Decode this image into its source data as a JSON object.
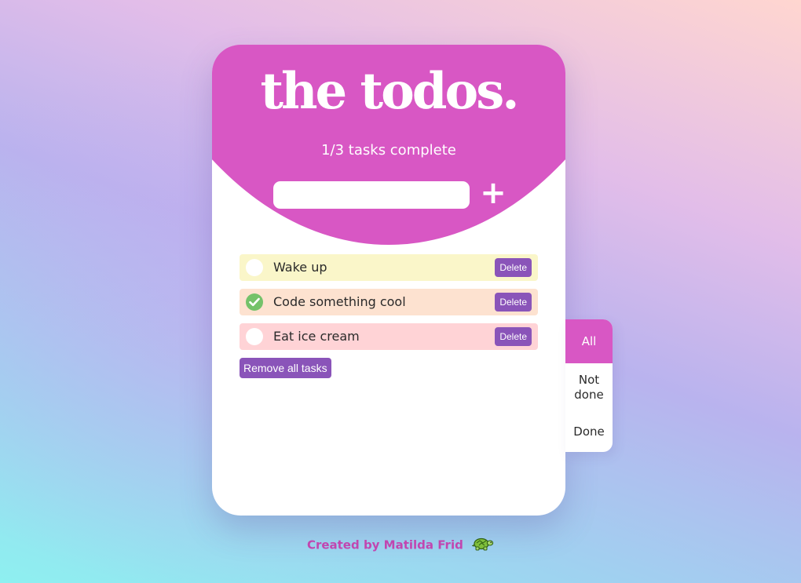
{
  "app": {
    "title": "the todos.",
    "progress_text": "1/3 tasks complete"
  },
  "new_task": {
    "value": "",
    "placeholder": "",
    "add_label": "+"
  },
  "tasks": [
    {
      "label": "Wake up",
      "done": false,
      "bg": "#faf6c9",
      "delete_label": "Delete"
    },
    {
      "label": "Code something cool",
      "done": true,
      "bg": "#fde2d0",
      "delete_label": "Delete"
    },
    {
      "label": "Eat ice cream",
      "done": false,
      "bg": "#ffd3d6",
      "delete_label": "Delete"
    }
  ],
  "remove_all_label": "Remove all tasks",
  "filter": {
    "options": [
      "All",
      "Not done",
      "Done"
    ],
    "selected": "All"
  },
  "footer": {
    "text": "Created by Matilda Frid",
    "icon": "turtle-icon"
  },
  "colors": {
    "accent": "#d857c4",
    "button": "#8a54b9",
    "check_done": "#74c26a",
    "footer_text": "#c146b0"
  }
}
